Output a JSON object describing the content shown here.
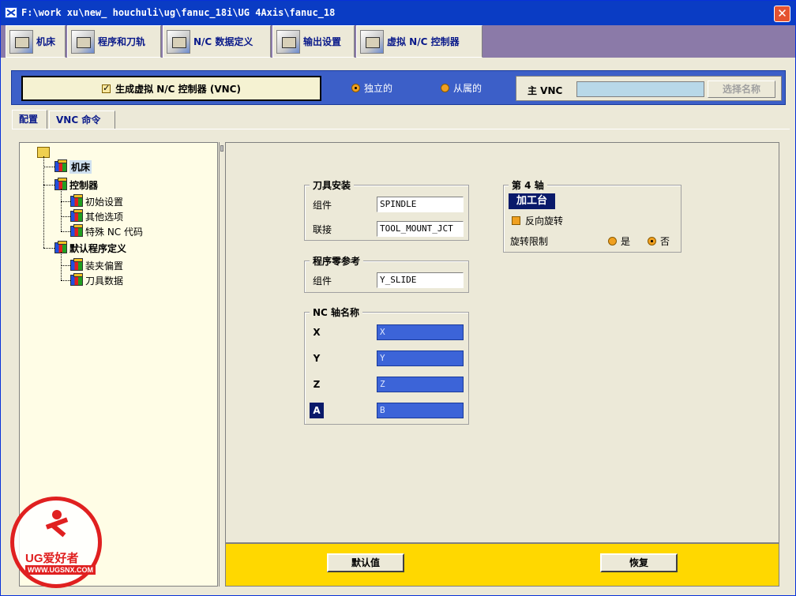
{
  "window": {
    "title": "F:\\work xu\\new_ houchuli\\ug\\fanuc_18i\\UG 4Axis\\fanuc_18",
    "close_label": "✕"
  },
  "tabs": [
    {
      "label": "机床",
      "icon": "machine-icon"
    },
    {
      "label": "程序和刀轨",
      "icon": "program-path-icon"
    },
    {
      "label": "N/C 数据定义",
      "icon": "nc-data-icon"
    },
    {
      "label": "输出设置",
      "icon": "printer-icon"
    },
    {
      "label": "虚拟 N/C 控制器",
      "icon": "vnc-icon",
      "active": true
    }
  ],
  "vnc_band": {
    "generate_label": "生成虚拟 N/C 控制器 (VNC)",
    "generate_checked": true,
    "standalone_label": "独立的",
    "subordinate_label": "从属的",
    "master_vnc_label": "主 VNC",
    "master_vnc_value": "",
    "select_name_label": "选择名称"
  },
  "subtabs": [
    {
      "label": "配置",
      "active": true
    },
    {
      "label": "VNC 命令",
      "active": false
    }
  ],
  "tree": {
    "nodes": [
      {
        "label": "机床",
        "selected": true
      },
      {
        "label": "控制器"
      },
      {
        "label": "初始设置"
      },
      {
        "label": "其他选项"
      },
      {
        "label": "特殊 NC 代码"
      },
      {
        "label": "默认程序定义"
      },
      {
        "label": "装夹偏置"
      },
      {
        "label": "刀具数据"
      }
    ]
  },
  "tool_mount": {
    "title": "刀具安装",
    "component_label": "组件",
    "component_value": "SPINDLE",
    "junction_label": "联接",
    "junction_value": "TOOL_MOUNT_JCT"
  },
  "program_zero": {
    "title": "程序零参考",
    "component_label": "组件",
    "component_value": "Y_SLIDE"
  },
  "nc_axis": {
    "title": "NC 轴名称",
    "axes": [
      {
        "label": "X",
        "value": "X"
      },
      {
        "label": "Y",
        "value": "Y"
      },
      {
        "label": "Z",
        "value": "Z"
      },
      {
        "label": "A",
        "value": "B",
        "selected": true
      }
    ]
  },
  "fourth_axis": {
    "title": "第 4 轴",
    "type_label": "加工台",
    "reverse_label": "反向旋转",
    "limit_label": "旋转限制",
    "yes_label": "是",
    "no_label": "否",
    "limit_value": "否"
  },
  "footer": {
    "default_label": "默认值",
    "restore_label": "恢复"
  },
  "watermark": {
    "brand": "UG爱好者",
    "url": "WWW.UGSNX.COM"
  },
  "colors": {
    "titlebar": "#0a3cc4",
    "band": "#3c5fc8",
    "footer": "#ffd800",
    "tabstrip": "#8b7aa8"
  }
}
